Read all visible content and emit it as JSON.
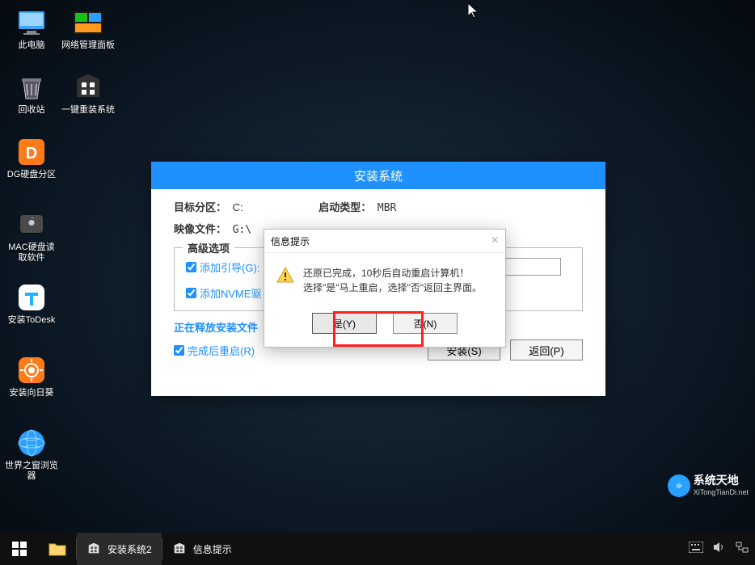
{
  "desktop": {
    "icons_top_row": [
      {
        "label": "此电脑",
        "name": "this-pc-icon"
      },
      {
        "label": "网络管理面板",
        "name": "network-panel-icon"
      }
    ],
    "icons_second_row": [
      {
        "label": "回收站",
        "name": "recycle-bin-icon"
      },
      {
        "label": "一键重装系统",
        "name": "reinstall-os-icon"
      }
    ],
    "icons_col": [
      {
        "label": "DG硬盘分区",
        "name": "diskgenius-icon"
      },
      {
        "label": "MAC硬盘读取软件",
        "name": "mac-disk-icon"
      },
      {
        "label": "安装ToDesk",
        "name": "todesk-icon"
      },
      {
        "label": "安装向日葵",
        "name": "sunlogin-icon"
      },
      {
        "label": "世界之窗浏览器",
        "name": "theworld-browser-icon"
      }
    ]
  },
  "installer": {
    "title": "安装系统",
    "target_label": "目标分区：",
    "target_value": "C:",
    "boot_label": "启动类型：",
    "boot_value": "MBR",
    "image_label": "映像文件：",
    "image_value": "G:\\",
    "adv_legend": "高级选项",
    "chk_add_boot": "添加引导(G):",
    "chk_add_nvme": "添加NVME驱",
    "progress_label": "正在释放安装文件",
    "chk_reboot": "完成后重启(R)",
    "btn_install": "安装(S)",
    "btn_back": "返回(P)"
  },
  "modal": {
    "title": "信息提示",
    "line1": "还原已完成，10秒后自动重启计算机！",
    "line2": "选择\"是\"马上重启，选择\"否\"返回主界面。",
    "btn_yes": "是(Y)",
    "btn_no": "否(N)"
  },
  "taskbar": {
    "item1": "安装系统2",
    "item2": "信息提示"
  },
  "watermark": {
    "title": "系统天地",
    "url": "XiTongTianDi.net"
  }
}
